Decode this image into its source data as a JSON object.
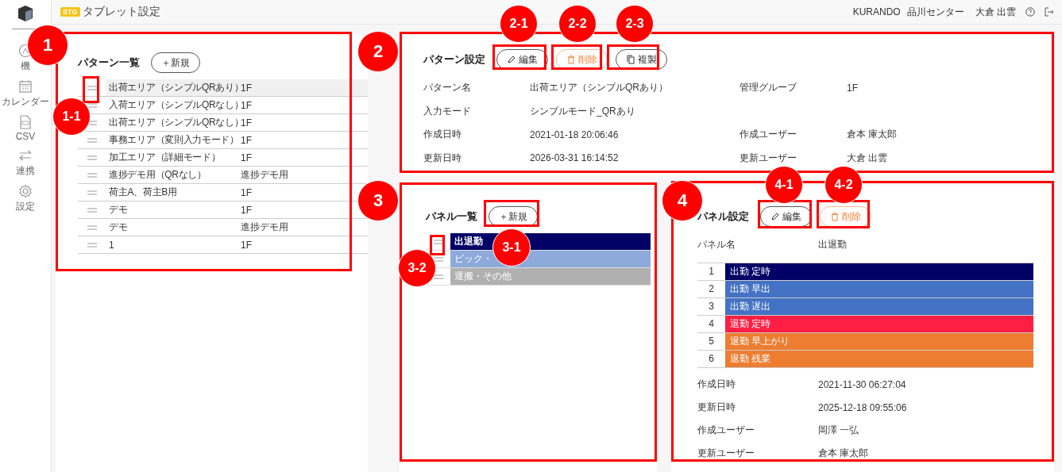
{
  "header": {
    "env_badge": "STG",
    "title": "タブレット設定",
    "company": "KURANDO",
    "center": "品川センター",
    "user": "大倉 出雲"
  },
  "sidebar": {
    "items": [
      {
        "kind": "grid",
        "label": "機"
      },
      {
        "kind": "calendar",
        "label": "カレンダー"
      },
      {
        "kind": "csv",
        "label": "CSV"
      },
      {
        "kind": "sync",
        "label": "連携"
      },
      {
        "kind": "gear",
        "label": "設定"
      }
    ]
  },
  "pattern_list": {
    "title": "パターン一覧",
    "new_button": "＋新規",
    "rows": [
      {
        "name": "出荷エリア（シンプルQRあり）",
        "group": "1F",
        "selected": true
      },
      {
        "name": "入荷エリア（シンプルQRなし）",
        "group": "1F",
        "selected": false
      },
      {
        "name": "出荷エリア（シンプルQRなし）",
        "group": "1F",
        "selected": false
      },
      {
        "name": "事務エリア（変則入力モード）",
        "group": "1F",
        "selected": false
      },
      {
        "name": "加工エリア（詳細モード）",
        "group": "1F",
        "selected": false
      },
      {
        "name": "進捗デモ用（QRなし）",
        "group": "進捗デモ用",
        "selected": false
      },
      {
        "name": "荷主A、荷主B用",
        "group": "1F",
        "selected": false
      },
      {
        "name": "デモ",
        "group": "1F",
        "selected": false
      },
      {
        "name": "デモ",
        "group": "進捗デモ用",
        "selected": false
      },
      {
        "name": "1",
        "group": "1F",
        "selected": false
      }
    ]
  },
  "pattern_settings": {
    "title": "パターン設定",
    "buttons": [
      {
        "kind": "edit",
        "label": "編集"
      },
      {
        "kind": "delete",
        "label": "削除"
      },
      {
        "kind": "copy",
        "label": "複製"
      }
    ],
    "field_rows": [
      {
        "cells": [
          {
            "label": "パターン名",
            "value": "出荷エリア（シンプルQRあり）"
          },
          {
            "label": "管理グループ",
            "value": "1F"
          }
        ]
      },
      {
        "cells": [
          {
            "label": "入力モード",
            "value": "シンプルモード_QRあり"
          }
        ]
      },
      {
        "cells": [
          {
            "label": "作成日時",
            "value": "2021-01-18 20:06:46"
          },
          {
            "label": "作成ユーザー",
            "value": "倉本 庫太郎"
          }
        ]
      },
      {
        "cells": [
          {
            "label": "更新日時",
            "value": "2026-03-31 16:14:52"
          },
          {
            "label": "更新ユーザー",
            "value": "大倉 出雲"
          }
        ]
      }
    ]
  },
  "panel_list": {
    "title": "パネル一覧",
    "new_button": "＋新規",
    "rows": [
      {
        "name": "出退勤",
        "color": "#000066",
        "selected": true
      },
      {
        "name": "ピック・",
        "color": "#8eaadb",
        "selected": false
      },
      {
        "name": "運搬・その他",
        "color": "#b0b0b0",
        "selected": false
      }
    ]
  },
  "panel_settings": {
    "title": "パネル設定",
    "buttons": [
      {
        "kind": "edit",
        "label": "編集"
      },
      {
        "kind": "delete",
        "label": "削除"
      }
    ],
    "name_label": "パネル名",
    "name_value": "出退勤",
    "buttons_table": [
      {
        "number": "1",
        "label": "出勤 定時",
        "color": "#000066"
      },
      {
        "number": "2",
        "label": "出勤 早出",
        "color": "#4472c4"
      },
      {
        "number": "3",
        "label": "出勤 遅出",
        "color": "#4472c4"
      },
      {
        "number": "4",
        "label": "退勤 定時",
        "color": "#ff1f44"
      },
      {
        "number": "5",
        "label": "退勤 早上がり",
        "color": "#ed7d31"
      },
      {
        "number": "6",
        "label": "退勤 残業",
        "color": "#ed7d31"
      }
    ],
    "fields": [
      {
        "label": "作成日時",
        "value": "2021-11-30 06:27:04"
      },
      {
        "label": "更新日時",
        "value": "2025-12-18 09:55:06"
      },
      {
        "label": "作成ユーザー",
        "value": "岡澤 一弘"
      },
      {
        "label": "更新ユーザー",
        "value": "倉本 庫太郎"
      }
    ]
  },
  "annotations": [
    {
      "kind": "frame"
    },
    {
      "kind": "frame"
    },
    {
      "kind": "frame"
    },
    {
      "kind": "frame"
    },
    {
      "kind": "frame"
    },
    {
      "kind": "frame"
    },
    {
      "kind": "frame"
    },
    {
      "kind": "frame"
    },
    {
      "kind": "frame"
    },
    {
      "kind": "frame"
    },
    {
      "kind": "frame"
    },
    {
      "kind": "frame"
    },
    {
      "kind": "callout",
      "label": "1"
    },
    {
      "kind": "callout",
      "label": "1-1"
    },
    {
      "kind": "callout",
      "label": "2"
    },
    {
      "kind": "callout",
      "label": "2-1"
    },
    {
      "kind": "callout",
      "label": "2-2"
    },
    {
      "kind": "callout",
      "label": "2-3"
    },
    {
      "kind": "callout",
      "label": "3"
    },
    {
      "kind": "callout",
      "label": "3-1"
    },
    {
      "kind": "callout",
      "label": "3-2"
    },
    {
      "kind": "callout",
      "label": "4"
    },
    {
      "kind": "callout",
      "label": "4-1"
    },
    {
      "kind": "callout",
      "label": "4-2"
    }
  ]
}
